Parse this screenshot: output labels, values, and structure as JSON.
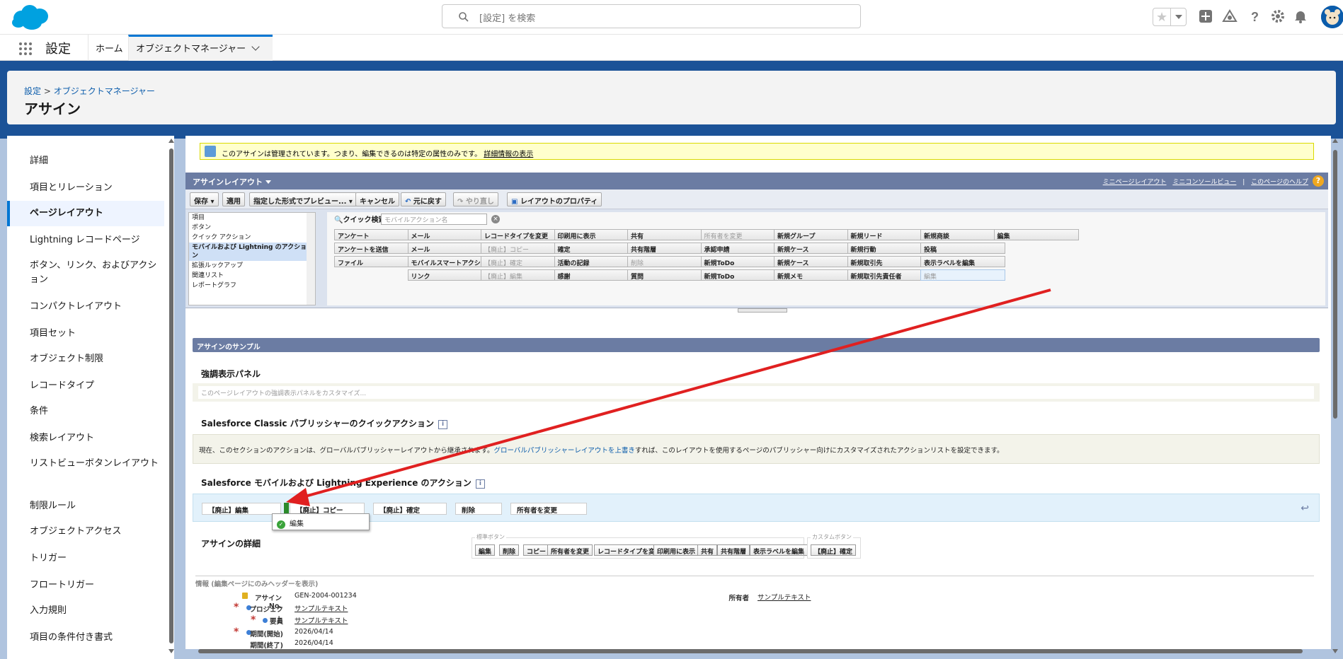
{
  "header": {
    "search_placeholder": "[設定] を検索"
  },
  "nav": {
    "app_name": "設定",
    "tabs": [
      {
        "label": "ホーム"
      },
      {
        "label": "オブジェクトマネージャー"
      }
    ]
  },
  "page": {
    "breadcrumb_root": "設定",
    "breadcrumb_sep": " > ",
    "breadcrumb_current": "オブジェクトマネージャー",
    "title": "アサイン"
  },
  "sidebar": {
    "items": [
      {
        "label": "詳細"
      },
      {
        "label": "項目とリレーション"
      },
      {
        "label": "ページレイアウト"
      },
      {
        "label": "Lightning レコードページ"
      },
      {
        "label": "ボタン、リンク、およびアクション"
      },
      {
        "label": "コンパクトレイアウト"
      },
      {
        "label": "項目セット"
      },
      {
        "label": "オブジェクト制限"
      },
      {
        "label": "レコードタイプ"
      },
      {
        "label": "条件"
      },
      {
        "label": "検索レイアウト"
      },
      {
        "label": "リストビューボタンレイアウト"
      },
      {
        "label": "制限ルール"
      },
      {
        "label": "オブジェクトアクセス"
      },
      {
        "label": "トリガー"
      },
      {
        "label": "フロートリガー"
      },
      {
        "label": "入力規則"
      },
      {
        "label": "項目の条件付き書式"
      }
    ]
  },
  "banner": {
    "text": "このアサインは管理されています。つまり、編集できるのは特定の属性のみです。",
    "link": "詳細情報の表示"
  },
  "layout_editor": {
    "title": "アサインレイアウト",
    "links": [
      "ミニページレイアウト",
      "ミニコンソールビュー",
      "このページのヘルプ"
    ],
    "help_glyph": "?",
    "toolbar": [
      "保存",
      "適用",
      "指定した形式でプレビュー...",
      "キャンセル",
      "元に戻す",
      "やり直し",
      "レイアウトのプロパティ"
    ],
    "palette_categories": [
      "項目",
      "ボタン",
      "クイック アクション",
      "モバイルおよび Lightning のアクション",
      "拡張ルックアップ",
      "関連リスト",
      "レポートグラフ"
    ],
    "quick_find_label": "クイック検索",
    "quick_find_placeholder": "モバイルアクション名",
    "quick_find_clear": "×",
    "palette_columns": [
      [
        "アンケート",
        "アンケートを送信",
        "ファイル"
      ],
      [
        "メール",
        "メール",
        "モバイルスマートアクション",
        "リンク"
      ],
      [
        "レコードタイプを変更",
        "【廃止】コピー",
        "【廃止】確定",
        "【廃止】編集"
      ],
      [
        "印刷用に表示",
        "確定",
        "活動の記録",
        "感謝"
      ],
      [
        "共有",
        "共有階層",
        "削除",
        "質問"
      ],
      [
        "所有者を変更",
        "承認申請",
        "新規ToDo",
        "新規ToDo"
      ],
      [
        "新規グループ",
        "新規ケース",
        "新規ケース",
        "新規メモ"
      ],
      [
        "新規リード",
        "新規行動",
        "新規取引先",
        "新規取引先責任者"
      ],
      [
        "新規商談",
        "投稿",
        "表示ラベルを編集",
        "編集"
      ],
      [
        "編集"
      ]
    ]
  },
  "sample": {
    "header": "アサインのサンプル",
    "highlights_title": "強調表示パネル",
    "highlights_placeholder": "このページレイアウトの強調表示パネルをカスタマイズ...",
    "publisher_title": "Salesforce Classic パブリッシャーのクイックアクション",
    "info_glyph": "i",
    "publisher_text": "現在、このセクションのアクションは、グローバルパブリッシャーレイアウトから継承されます。",
    "publisher_link": "グローバルパブリッシャーレイアウトを上書き",
    "publisher_text2": "すれば、このレイアウトを使用するページのパブリッシャー向けにカスタマイズされたアクションリストを設定できます。",
    "mobile_title": "Salesforce モバイルおよび Lightning Experience のアクション",
    "mobile_actions": [
      "【廃止】編集",
      "【廃止】コピー",
      "【廃止】確定",
      "削除",
      "所有者を変更"
    ],
    "undo_glyph": "↩",
    "popup_label": "編集",
    "popup_glyph": "✓",
    "details_title": "アサインの詳細",
    "standard_buttons_label": "標準ボタン",
    "standard_buttons": [
      "編集",
      "削除",
      "コピー",
      "所有者を変更",
      "レコードタイプを変更",
      "印刷用に表示",
      "共有",
      "共有階層",
      "表示ラベルを編集"
    ],
    "custom_buttons_label": "カスタムボタン",
    "custom_buttons": [
      "【廃止】確定"
    ],
    "info_section": "情報 (編集ページにのみヘッダーを表示)",
    "required_glyph": "*",
    "fields": [
      {
        "label": "アサイン No.",
        "value": "GEN-2004-001234"
      },
      {
        "label": "プロジェクト",
        "value": "サンプルテキスト"
      },
      {
        "label": "要員",
        "value": "サンプルテキスト"
      },
      {
        "label": "期間(開始)",
        "value": "2026/04/14"
      },
      {
        "label": "期間(終了)",
        "value": "2026/04/14"
      }
    ],
    "owner_label": "所有者",
    "owner_value": "サンプルテキスト"
  },
  "colors": {
    "brand": "#0176d3",
    "annotation_arrow": "#e02020"
  }
}
